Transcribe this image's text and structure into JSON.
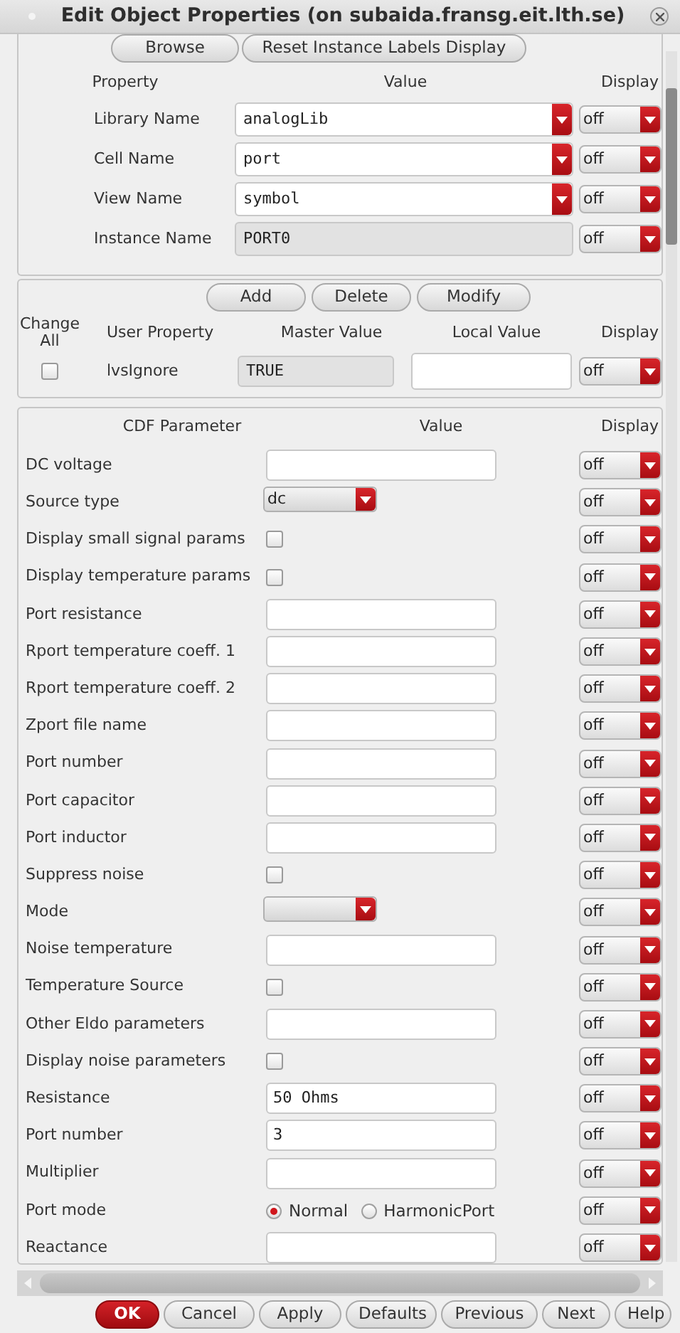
{
  "window": {
    "title": "Edit Object Properties (on subaida.fransg.eit.lth.se)"
  },
  "top_buttons": [
    "Browse",
    "Reset Instance Labels Display"
  ],
  "instance_columns": [
    "Property",
    "Value",
    "Display"
  ],
  "instance_properties": [
    {
      "label": "Library Name",
      "value": "analogLib",
      "editable": true,
      "display": "off"
    },
    {
      "label": "Cell Name",
      "value": "port",
      "editable": true,
      "display": "off"
    },
    {
      "label": "View Name",
      "value": "symbol",
      "editable": true,
      "display": "off"
    },
    {
      "label": "Instance Name",
      "value": "PORT0",
      "editable": false,
      "display": "off"
    }
  ],
  "user_buttons": [
    "Add",
    "Delete",
    "Modify"
  ],
  "user_columns": [
    "Change All",
    "User Property",
    "Master Value",
    "Local Value",
    "Display"
  ],
  "user_properties": [
    {
      "change_all": false,
      "name": "lvsIgnore",
      "master_value": "TRUE",
      "display": "off"
    }
  ],
  "cdf_columns": [
    "CDF Parameter",
    "Value",
    "Display"
  ],
  "cdf_parameters": [
    {
      "label": "DC voltage",
      "kind": "text",
      "display": "off"
    },
    {
      "label": "Source type",
      "kind": "combo",
      "value": "dc",
      "display": "off"
    },
    {
      "label": "Display small signal params",
      "kind": "checkbox",
      "checked": false,
      "display": "off"
    },
    {
      "label": "Display temperature params",
      "kind": "checkbox",
      "checked": false,
      "display": "off"
    },
    {
      "label": "Port resistance",
      "kind": "text",
      "display": "off"
    },
    {
      "label": "Rport temperature coeff. 1",
      "kind": "text",
      "display": "off"
    },
    {
      "label": "Rport temperature coeff. 2",
      "kind": "text",
      "display": "off"
    },
    {
      "label": "Zport file name",
      "kind": "text",
      "display": "off"
    },
    {
      "label": "Port number",
      "kind": "text",
      "display": "off"
    },
    {
      "label": "Port capacitor",
      "kind": "text",
      "display": "off"
    },
    {
      "label": "Port inductor",
      "kind": "text",
      "display": "off"
    },
    {
      "label": "Suppress noise",
      "kind": "checkbox",
      "checked": false,
      "display": "off"
    },
    {
      "label": "Mode",
      "kind": "combo",
      "display": "off"
    },
    {
      "label": "Noise temperature",
      "kind": "text",
      "display": "off"
    },
    {
      "label": "Temperature Source",
      "kind": "checkbox",
      "checked": false,
      "display": "off"
    },
    {
      "label": "Other Eldo parameters",
      "kind": "text",
      "display": "off"
    },
    {
      "label": "Display noise parameters",
      "kind": "checkbox",
      "checked": false,
      "display": "off"
    },
    {
      "label": "Resistance",
      "kind": "text",
      "value": "50 Ohms",
      "display": "off"
    },
    {
      "label": "Port number",
      "kind": "text",
      "value": "3",
      "display": "off"
    },
    {
      "label": "Multiplier",
      "kind": "text",
      "display": "off"
    },
    {
      "label": "Port mode",
      "kind": "radio",
      "options": [
        {
          "label": "Normal",
          "selected": true
        },
        {
          "label": "HarmonicPort",
          "selected": false
        }
      ],
      "display": "off"
    },
    {
      "label": "Reactance",
      "kind": "text",
      "display": "off"
    }
  ],
  "bottom_buttons": [
    {
      "label": "OK",
      "primary": true
    },
    {
      "label": "Cancel",
      "primary": false
    },
    {
      "label": "Apply",
      "primary": false
    },
    {
      "label": "Defaults",
      "primary": false
    },
    {
      "label": "Previous",
      "primary": false
    },
    {
      "label": "Next",
      "primary": false
    },
    {
      "label": "Help",
      "primary": false
    }
  ]
}
